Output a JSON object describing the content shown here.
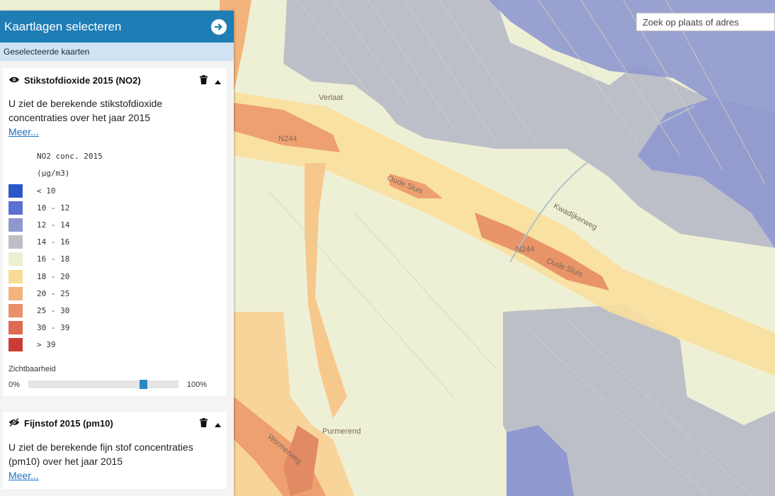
{
  "panel": {
    "title": "Kaartlagen selecteren",
    "subheader": "Geselecteerde kaarten"
  },
  "search": {
    "placeholder": "Zoek op plaats of adres"
  },
  "layers": [
    {
      "name": "Stikstofdioxide 2015 (NO2)",
      "description": "U ziet de berekende stikstofdioxide concentraties over het jaar 2015",
      "more": "Meer...",
      "legend": {
        "title": "NO2 conc. 2015",
        "unit": "(µg/m3)",
        "classes": [
          {
            "label": "< 10",
            "color": "#2a57c8"
          },
          {
            "label": "10 - 12",
            "color": "#5b70d2"
          },
          {
            "label": "12 - 14",
            "color": "#8e98cc"
          },
          {
            "label": "14 - 16",
            "color": "#bcbfc6"
          },
          {
            "label": "16 - 18",
            "color": "#eeefd0"
          },
          {
            "label": "18 - 20",
            "color": "#f8dc96"
          },
          {
            "label": "20 - 25",
            "color": "#f2b47c"
          },
          {
            "label": "25 - 30",
            "color": "#e8906a"
          },
          {
            "label": "30 - 39",
            "color": "#de6a52"
          },
          {
            "label": "> 39",
            "color": "#cc3c36"
          }
        ]
      },
      "visibility": {
        "label": "Zichtbaarheid",
        "min": "0%",
        "max": "100%",
        "value": 0.78
      }
    },
    {
      "name": "Fijnstof 2015 (pm10)",
      "description": "U ziet de berekende fijn stof concentraties (pm10) over het jaar 2015",
      "more": "Meer..."
    }
  ],
  "map": {
    "labels": [
      "N244",
      "Oude Sluis",
      "N244",
      "Oude Sluis",
      "Kwadijkerweg",
      "Purmerend",
      "Verlaat",
      "Wormerweg"
    ]
  }
}
